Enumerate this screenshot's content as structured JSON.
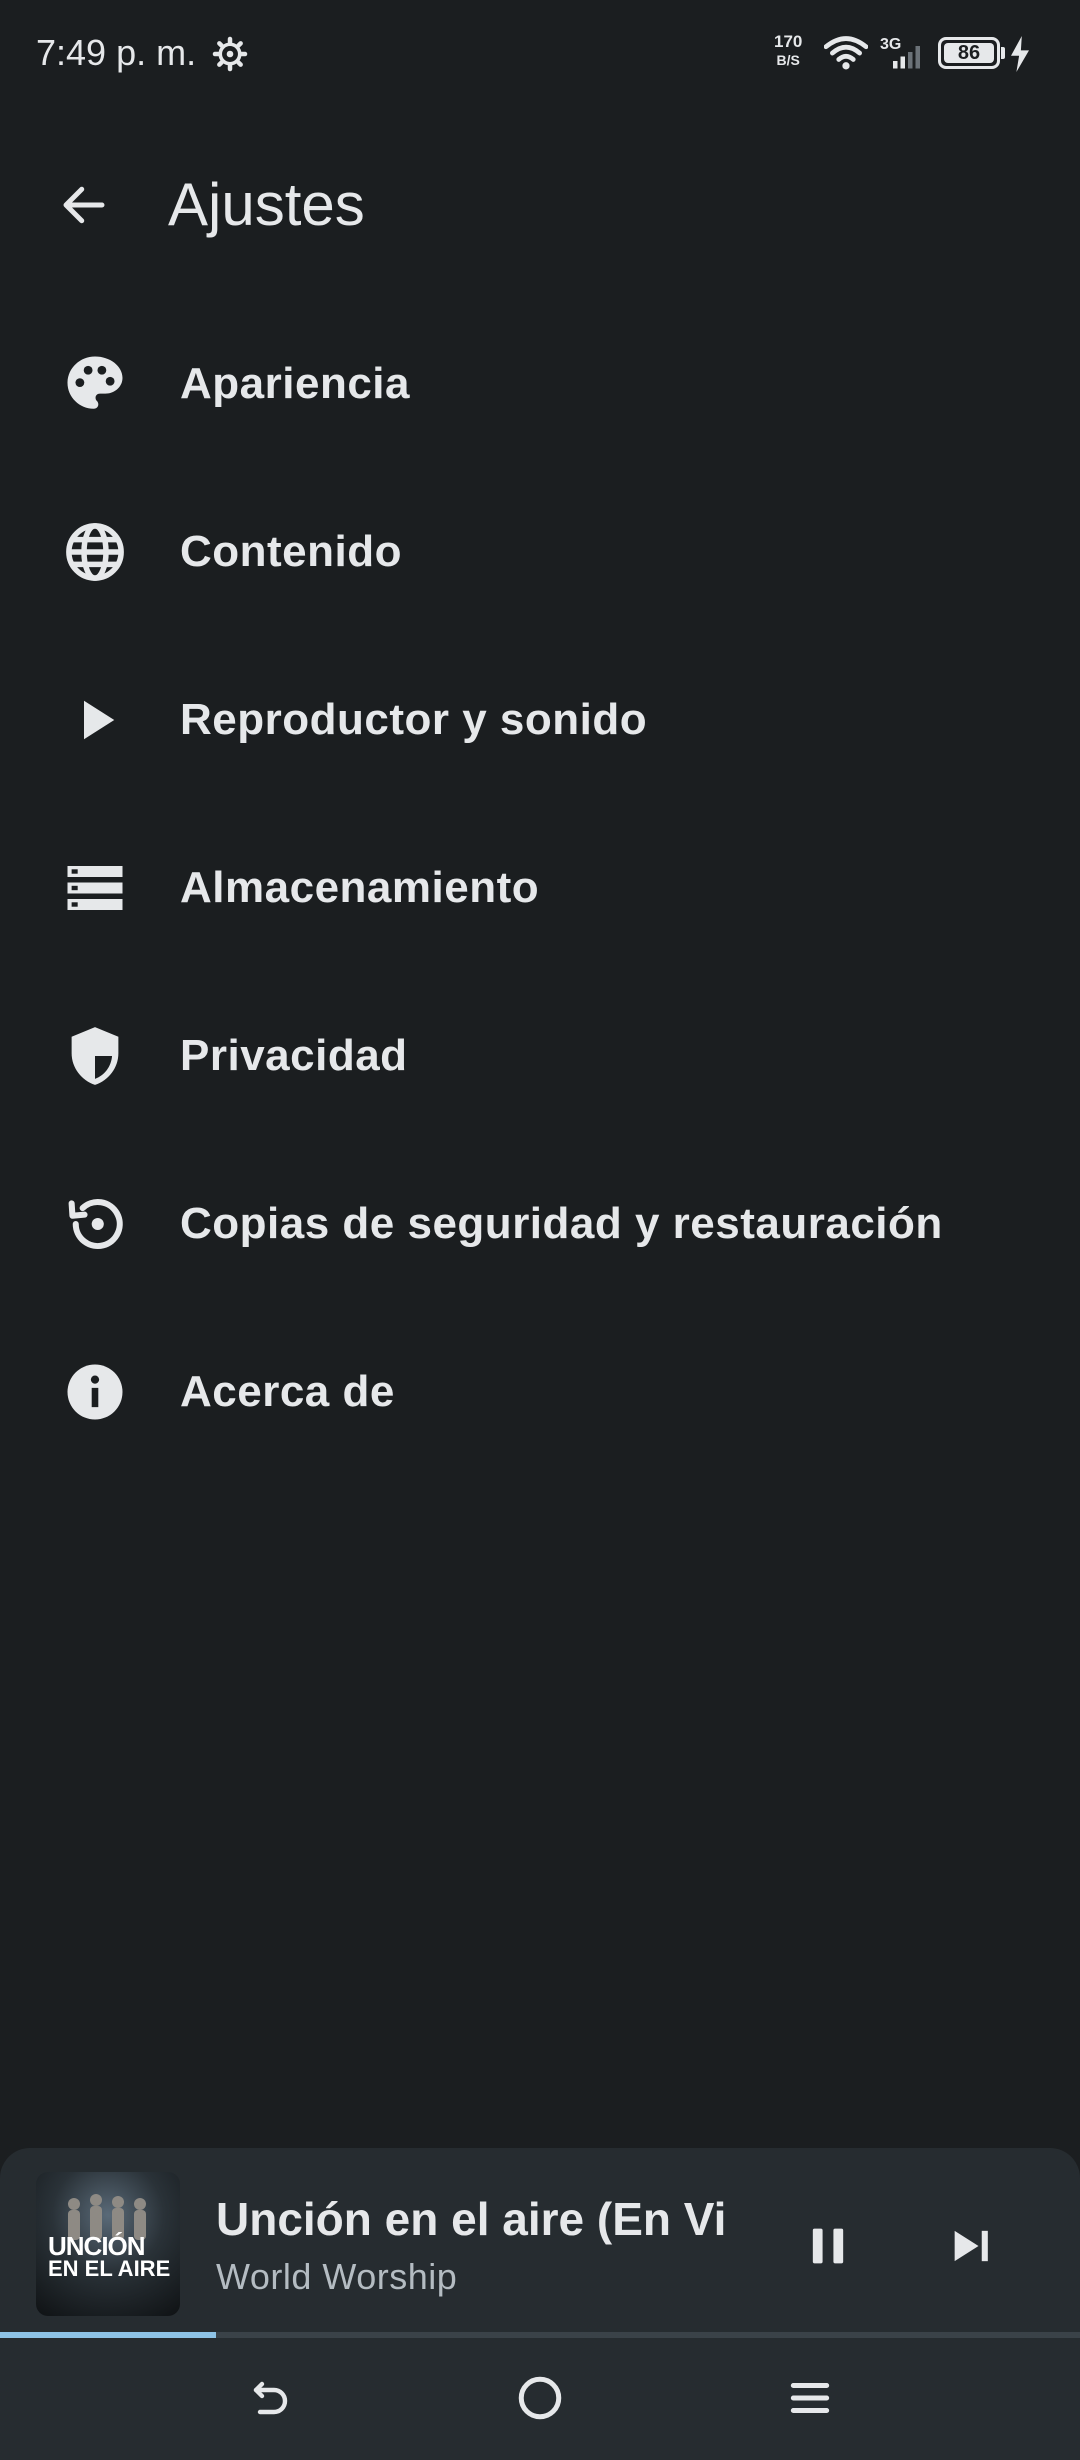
{
  "status_bar": {
    "time": "7:49 p. m.",
    "speed_value": "170",
    "speed_unit": "B/S",
    "network_type": "3G",
    "battery_level": "86"
  },
  "header": {
    "title": "Ajustes"
  },
  "settings": {
    "items": [
      {
        "label": "Apariencia",
        "icon": "palette-icon"
      },
      {
        "label": "Contenido",
        "icon": "globe-icon"
      },
      {
        "label": "Reproductor y sonido",
        "icon": "play-icon"
      },
      {
        "label": "Almacenamiento",
        "icon": "storage-icon"
      },
      {
        "label": "Privacidad",
        "icon": "shield-icon"
      },
      {
        "label": "Copias de seguridad y restauración",
        "icon": "restore-icon"
      },
      {
        "label": "Acerca de",
        "icon": "info-icon"
      }
    ]
  },
  "mini_player": {
    "track_title": "Unción en el aire (En Vivo)",
    "artist": "World Worship",
    "album_art_title": "UNCIÓN",
    "album_art_subtitle": "EN EL AIRE",
    "progress": 0.2,
    "progress_color": "#8ec3e6"
  },
  "colors": {
    "background": "#1b1e20",
    "surface": "#262c30",
    "text": "#e6e8ea",
    "accent": "#8ec3e6"
  }
}
